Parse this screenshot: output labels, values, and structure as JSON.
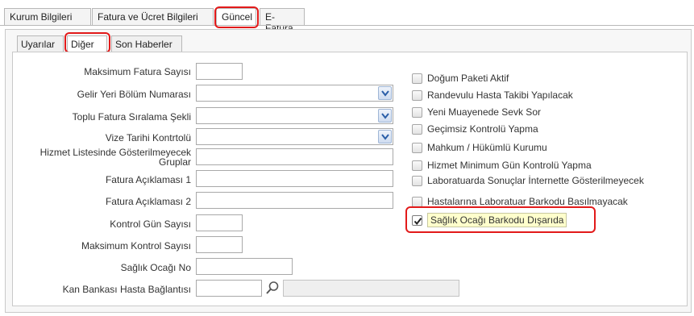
{
  "top_tabs": [
    {
      "label": "Kurum Bilgileri",
      "active": false
    },
    {
      "label": "Fatura ve Ücret Bilgileri",
      "active": false
    },
    {
      "label": "Güncel",
      "active": true
    },
    {
      "label": "E-Fatura",
      "active": false
    }
  ],
  "inner_tabs": [
    {
      "label": "Uyarılar",
      "active": false
    },
    {
      "label": "Diğer",
      "active": true
    },
    {
      "label": "Son Haberler",
      "active": false
    }
  ],
  "form": {
    "max_invoice": {
      "label": "Maksimum Fatura Sayısı",
      "value": ""
    },
    "revenue_section": {
      "label": "Gelir Yeri Bölüm Numarası",
      "value": ""
    },
    "bulk_invoice_sort": {
      "label": "Toplu Fatura Sıralama Şekli",
      "value": ""
    },
    "visa_date_check": {
      "label": "Vize Tarihi Kontrtolü",
      "value": ""
    },
    "hidden_services": {
      "label": "Hizmet Listesinde Gösterilmeyecek Gruplar",
      "value": ""
    },
    "invoice_note_1": {
      "label": "Fatura Açıklaması 1",
      "value": ""
    },
    "invoice_note_2": {
      "label": "Fatura Açıklaması 2",
      "value": ""
    },
    "control_days": {
      "label": "Kontrol Gün Sayısı",
      "value": ""
    },
    "max_control": {
      "label": "Maksimum Kontrol Sayısı",
      "value": ""
    },
    "health_center_no": {
      "label": "Sağlık Ocağı No",
      "value": ""
    },
    "blood_bank": {
      "label": "Kan Bankası Hasta Bağlantısı",
      "value": "",
      "name_value": ""
    }
  },
  "checkboxes": [
    {
      "label": "Doğum Paketi Aktif",
      "checked": false
    },
    {
      "label": "Randevulu Hasta Takibi Yapılacak",
      "checked": false
    },
    {
      "label": "Yeni Muayenede Sevk Sor",
      "checked": false
    },
    {
      "label": "Geçimsiz Kontrolü Yapma",
      "checked": false
    },
    {
      "label": "Mahkum / Hükümlü Kurumu",
      "checked": false
    },
    {
      "label": "Hizmet Minimum Gün Kontrolü Yapma",
      "checked": false
    },
    {
      "label": "Laboratuarda Sonuçlar İnternette Gösterilmeyecek",
      "checked": false
    },
    {
      "label": "Hastalarına Laboratuar Barkodu Basılmayacak",
      "checked": false
    },
    {
      "label": "Sağlık Ocağı Barkodu Dışarıda",
      "checked": true
    }
  ],
  "icons": {
    "dropdown": "chevron-down-icon",
    "search": "search-icon",
    "check": "check-icon"
  },
  "colors": {
    "highlight": "#e21a1a",
    "label_highlight": "#ffffcc",
    "arrow": "#2a5ea8"
  }
}
